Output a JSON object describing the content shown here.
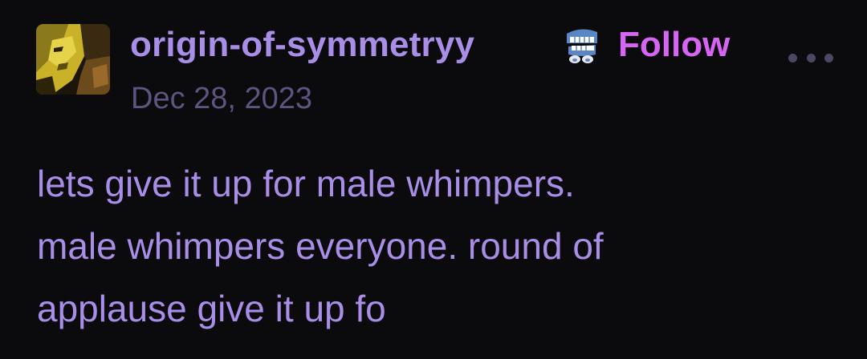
{
  "post": {
    "author": {
      "username": "origin-of-symmetryy",
      "avatar_icon": "avatar-image",
      "badge_icon": "chattering-teeth-badge-icon"
    },
    "follow_label": "Follow",
    "more_icon": "more-options-icon",
    "date": "Dec 28, 2023",
    "body": "lets give it up for male whimpers.\nmale whimpers everyone. round of\napplause give it up fo"
  },
  "colors": {
    "background": "#0b0a0d",
    "username": "#a98ee8",
    "follow": "#d665f4",
    "date": "#5f537f",
    "body_text": "#a98ee8",
    "more_dots": "#4d4766"
  }
}
